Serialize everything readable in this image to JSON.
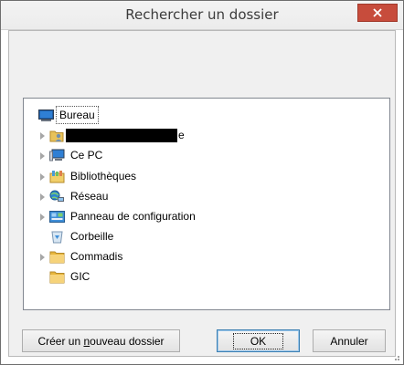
{
  "dialog": {
    "title": "Rechercher un dossier"
  },
  "tree": {
    "items": [
      {
        "label": "Bureau",
        "icon": "desktop-icon",
        "expandable": false,
        "selected": true
      },
      {
        "label": "e",
        "icon": "user-folder-icon",
        "expandable": true,
        "redacted": true
      },
      {
        "label": "Ce PC",
        "icon": "computer-icon",
        "expandable": true
      },
      {
        "label": "Bibliothèques",
        "icon": "libraries-icon",
        "expandable": true
      },
      {
        "label": "Réseau",
        "icon": "network-icon",
        "expandable": true
      },
      {
        "label": "Panneau de configuration",
        "icon": "control-panel-icon",
        "expandable": true
      },
      {
        "label": "Corbeille",
        "icon": "recycle-bin-icon",
        "expandable": false
      },
      {
        "label": "Commadis",
        "icon": "folder-icon",
        "expandable": true
      },
      {
        "label": "GIC",
        "icon": "folder-icon",
        "expandable": false
      }
    ]
  },
  "buttons": {
    "new_folder_pre": "Créer un ",
    "new_folder_mnemonic": "n",
    "new_folder_post": "ouveau dossier",
    "ok": "OK",
    "cancel": "Annuler"
  },
  "colors": {
    "close_button": "#c74c3c",
    "selection_outline": "#555555",
    "default_button_border": "#3c7fb1"
  }
}
